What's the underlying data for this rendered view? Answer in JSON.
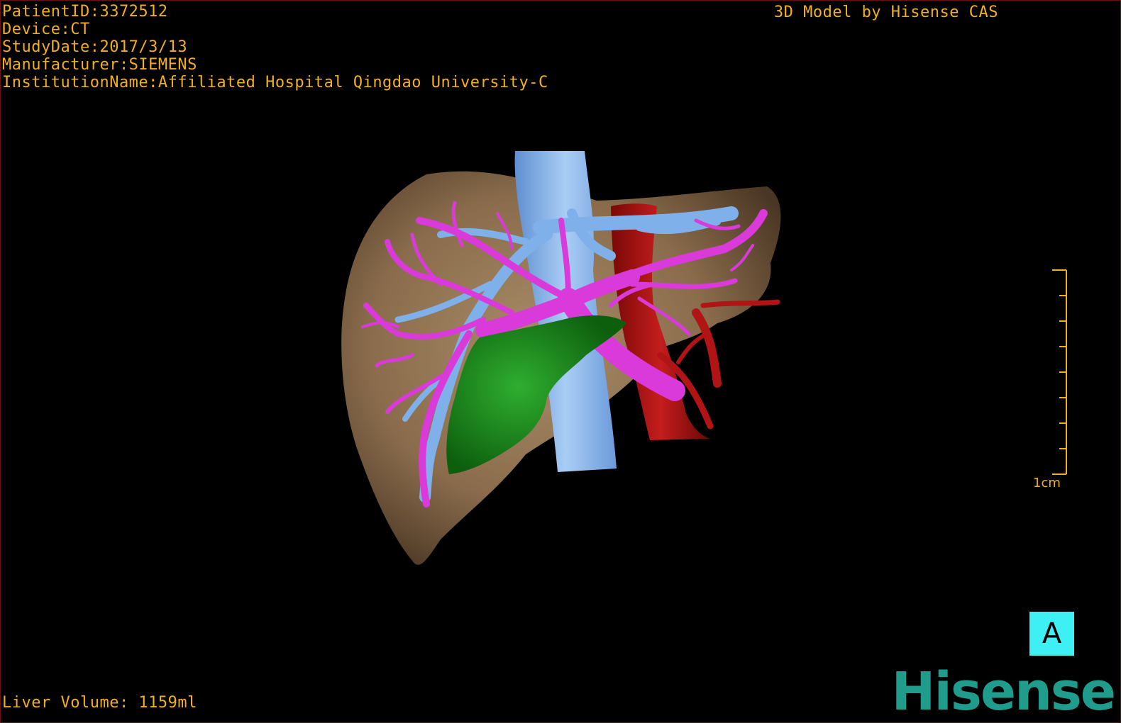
{
  "study": {
    "patient_id": "PatientID:3372512",
    "device": "Device:CT",
    "study_date": "StudyDate:2017/3/13",
    "manufacturer": "Manufacturer:SIEMENS",
    "institution": "InstitutionName:Affiliated Hospital Qingdao University-C"
  },
  "credit": "3D Model by Hisense CAS",
  "liver_volume": "Liver Volume: 1159ml",
  "scale_bar": {
    "label": "1cm"
  },
  "orientation": {
    "label": "A"
  },
  "brand": {
    "name": "Hisense"
  },
  "colors": {
    "text": "#f2b01e",
    "liver": "#8a6c4c",
    "portal_vein": "#d93ad9",
    "hepatic_vein": "#7fb0ea",
    "artery": "#b01414",
    "tumor": "#1f8f1f",
    "cube": "#3ef0f4",
    "brand": "#1f9c8c"
  }
}
